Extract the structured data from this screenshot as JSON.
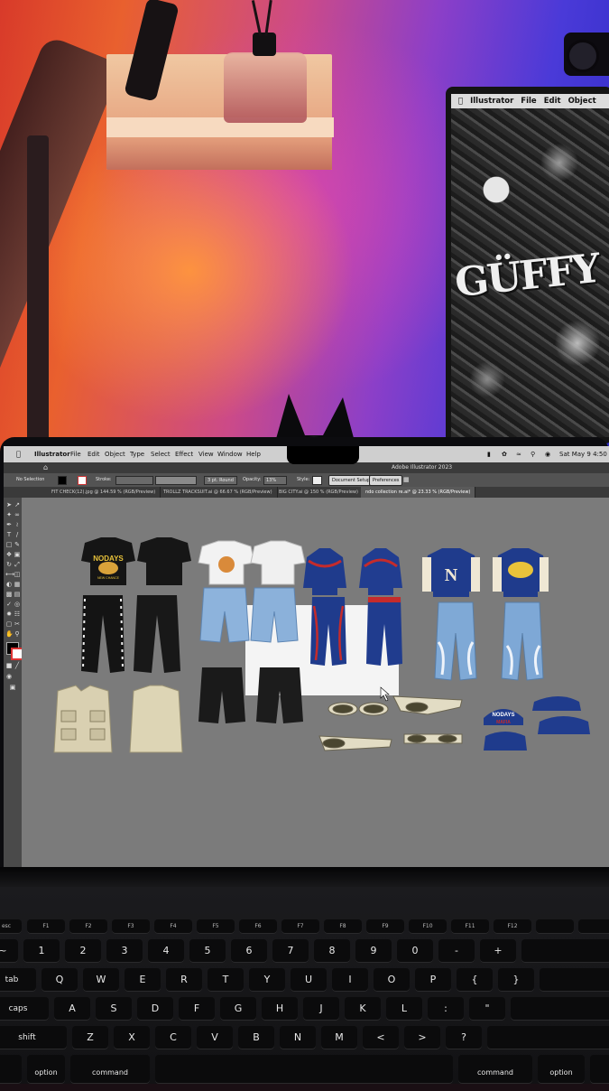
{
  "menubar": {
    "app": "Illustrator",
    "items": [
      "File",
      "Edit",
      "Object",
      "Type",
      "Select",
      "Effect",
      "View",
      "Window",
      "Help"
    ],
    "clock": "Sat May 9  4:50"
  },
  "window": {
    "title": "Adobe Illustrator 2023"
  },
  "control": {
    "selection": "No Selection",
    "stroke_label": "Stroke:",
    "brush": "3 pt. Round",
    "opacity_label": "Opacity:",
    "opacity_value": "13%",
    "style_label": "Style:",
    "doc_setup": "Document Setup",
    "preferences": "Preferences"
  },
  "tabs": [
    {
      "label": "FIT CHECK(12).jpg @ 144.59 % (RGB/Preview)",
      "active": false
    },
    {
      "label": "TROLLZ TRACKSUIT.ai @ 66.67 % (RGB/Preview)",
      "active": false
    },
    {
      "label": "BIG CITY.ai @ 150 % (RGB/Preview)",
      "active": false
    },
    {
      "label": "ndo collection re.ai* @ 23.33 % (RGB/Preview)",
      "active": true
    }
  ],
  "artwork": {
    "tee_print": "NODAYS",
    "tee_sub": "NEW CHANCE",
    "cap_print": "NODAYS",
    "cap_sub": "MAFIA",
    "jacket_letter": "N"
  },
  "monitor": {
    "menubar": {
      "app": "Illustrator",
      "items": [
        "File",
        "Edit",
        "Object"
      ]
    },
    "art_text": "GÜFFY"
  },
  "keyboard": {
    "fn_row": [
      "esc",
      "F1",
      "F2",
      "F3",
      "F4",
      "F5",
      "F6",
      "F7",
      "F8",
      "F9",
      "F10",
      "F11",
      "F12"
    ],
    "num_row": [
      "~",
      "1",
      "2",
      "3",
      "4",
      "5",
      "6",
      "7",
      "8",
      "9",
      "0",
      "-",
      "+"
    ],
    "top_row": [
      "tab",
      "Q",
      "W",
      "E",
      "R",
      "T",
      "Y",
      "U",
      "I",
      "O",
      "P",
      "{",
      "}"
    ],
    "home_row": [
      "caps",
      "A",
      "S",
      "D",
      "F",
      "G",
      "H",
      "J",
      "K",
      "L",
      ":",
      "\""
    ],
    "bottom_row": [
      "shift",
      "Z",
      "X",
      "C",
      "V",
      "B",
      "N",
      "M",
      "<",
      ">",
      "?"
    ],
    "mod_left": [
      "option",
      "command"
    ],
    "mod_right": [
      "command",
      "option"
    ]
  },
  "colors": {
    "navy": "#1f3b8c",
    "red": "#c52b2b",
    "denim": "#7fa9d6",
    "khaki": "#d8cfb0",
    "black": "#151515",
    "canvas_gray": "#7b7b7b"
  }
}
